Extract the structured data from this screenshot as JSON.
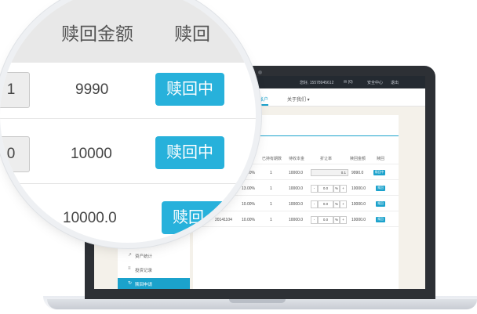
{
  "topbar": {
    "phone": "您好, 15578945612",
    "messages": "✉ (0)",
    "security": "安全中心",
    "logout": "退出"
  },
  "nav": {
    "my_account": "我的帐户",
    "about": "关于我们 ▾"
  },
  "sidebar": {
    "items": [
      {
        "icon": "chart-icon",
        "glyph": "↗",
        "label": "资产统计",
        "active": false
      },
      {
        "icon": "list-icon",
        "glyph": "≡",
        "label": "投资记录",
        "active": false
      },
      {
        "icon": "redeem-icon",
        "glyph": "↻",
        "label": "赎回申请",
        "active": true
      }
    ]
  },
  "table": {
    "columns": [
      "益率",
      "已持有期数",
      "待收本金",
      "折让率",
      "赎回金额",
      "赎回"
    ],
    "rows": [
      {
        "code": "",
        "rate": "10.00%",
        "periods": "1",
        "principal": "10000.0",
        "discount": "0.1",
        "amount": "9990.0",
        "action": "赎回中",
        "mode": "readonly"
      },
      {
        "code": "",
        "rate": "13.00%",
        "periods": "1",
        "principal": "10000.0",
        "discount": "0.0",
        "amount": "10000.0",
        "action": "赎回",
        "mode": "stepper"
      },
      {
        "code": "",
        "rate": "10.00%",
        "periods": "1",
        "principal": "10000.0",
        "discount": "0.0",
        "amount": "10000.0",
        "action": "赎回",
        "mode": "stepper"
      },
      {
        "code": "20141104",
        "rate": "10.00%",
        "periods": "1",
        "principal": "10000.0",
        "discount": "0.0",
        "amount": "10000.0",
        "action": "赎回",
        "mode": "stepper"
      }
    ],
    "stepper_minus": "-",
    "stepper_plus": "+",
    "percent": "%"
  },
  "magnifier": {
    "header_amount": "赎回金额",
    "header_redeem": "赎回",
    "rows": [
      {
        "partial_input": "1",
        "amount": "9990",
        "button": "赎回中"
      },
      {
        "partial_input": "0",
        "amount": "10000",
        "button": "赎回中"
      },
      {
        "partial_input": "",
        "amount": "10000.0",
        "button": "赎回"
      }
    ]
  },
  "colors": {
    "accent": "#1ba2cc",
    "topbar": "#242a31"
  }
}
